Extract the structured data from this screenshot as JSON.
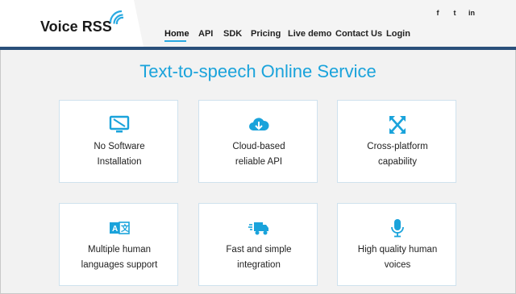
{
  "header": {
    "logo": "Voice RSS",
    "social": [
      "f",
      "t",
      "in"
    ],
    "nav": [
      "Home",
      "API",
      "SDK",
      "Pricing",
      "Live demo",
      "Contact Us",
      "Login"
    ],
    "active_nav": "Home"
  },
  "main": {
    "title": "Text-to-speech Online Service",
    "features": [
      {
        "icon": "monitor-off-icon",
        "line1": "No Software",
        "line2": "Installation"
      },
      {
        "icon": "cloud-download-icon",
        "line1": "Cloud-based",
        "line2": "reliable API"
      },
      {
        "icon": "expand-arrows-icon",
        "line1": "Cross-platform",
        "line2": "capability"
      },
      {
        "icon": "language-icon",
        "line1": "Multiple human",
        "line2": "languages support"
      },
      {
        "icon": "fast-truck-icon",
        "line1": "Fast and simple",
        "line2": "integration"
      },
      {
        "icon": "microphone-icon",
        "line1": "High quality human",
        "line2": "voices"
      }
    ]
  },
  "colors": {
    "accent": "#1aa3db",
    "bar": "#2a4f7a"
  }
}
